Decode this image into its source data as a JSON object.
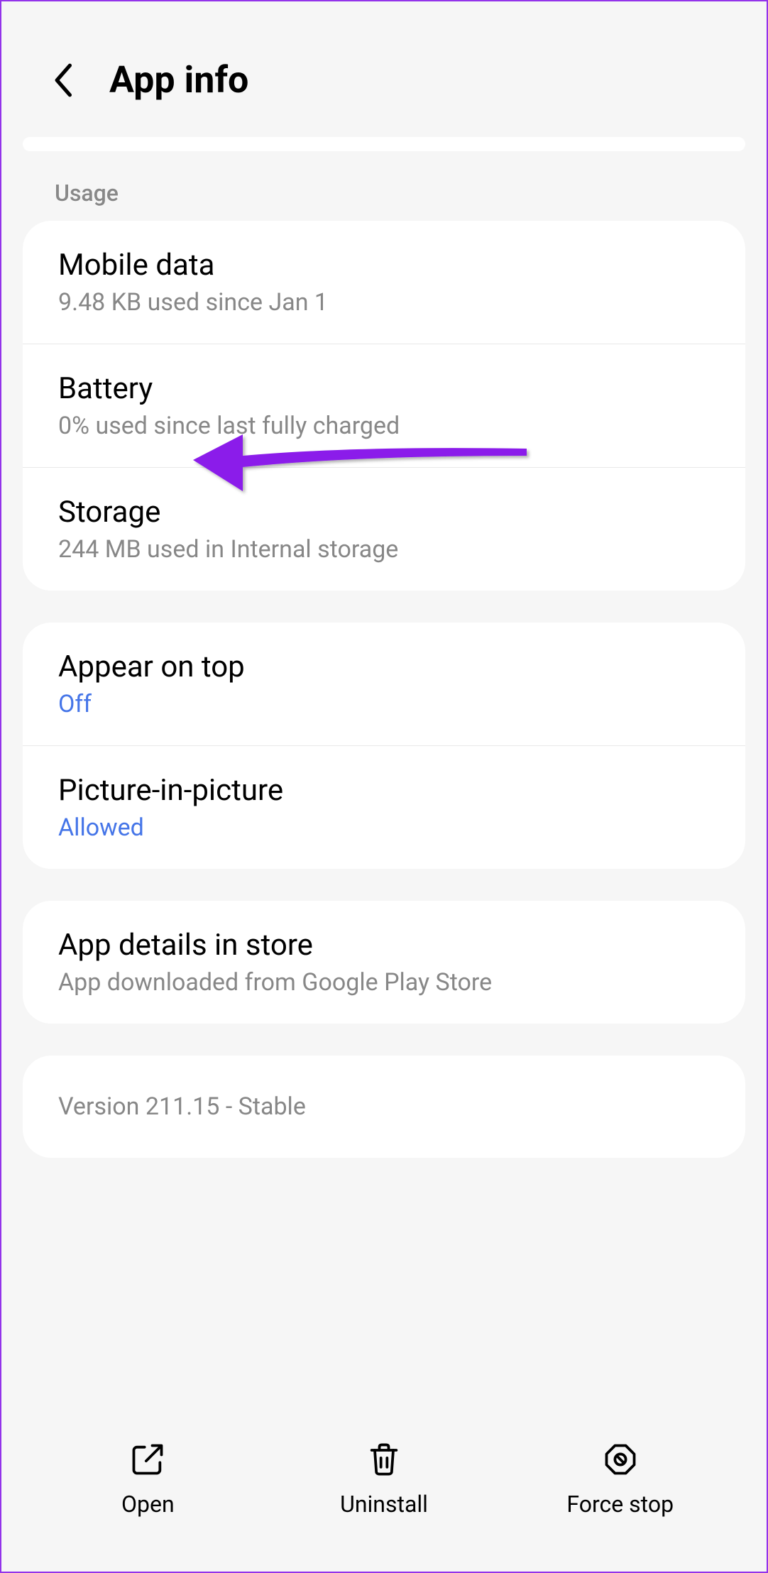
{
  "header": {
    "title": "App info"
  },
  "sections": {
    "usage": {
      "label": "Usage",
      "items": [
        {
          "title": "Mobile data",
          "subtitle": "9.48 KB used since Jan 1"
        },
        {
          "title": "Battery",
          "subtitle": "0% used since last fully charged"
        },
        {
          "title": "Storage",
          "subtitle": "244 MB used in Internal storage"
        }
      ]
    },
    "display": {
      "items": [
        {
          "title": "Appear on top",
          "status": "Off"
        },
        {
          "title": "Picture-in-picture",
          "status": "Allowed"
        }
      ]
    },
    "store": {
      "title": "App details in store",
      "subtitle": "App downloaded from Google Play Store"
    },
    "version": "Version 211.15 - Stable"
  },
  "bottomBar": {
    "open": "Open",
    "uninstall": "Uninstall",
    "forceStop": "Force stop"
  },
  "colors": {
    "accent": "#9333ea",
    "link": "#4575e8",
    "textPrimary": "#000",
    "textSecondary": "#878787"
  }
}
